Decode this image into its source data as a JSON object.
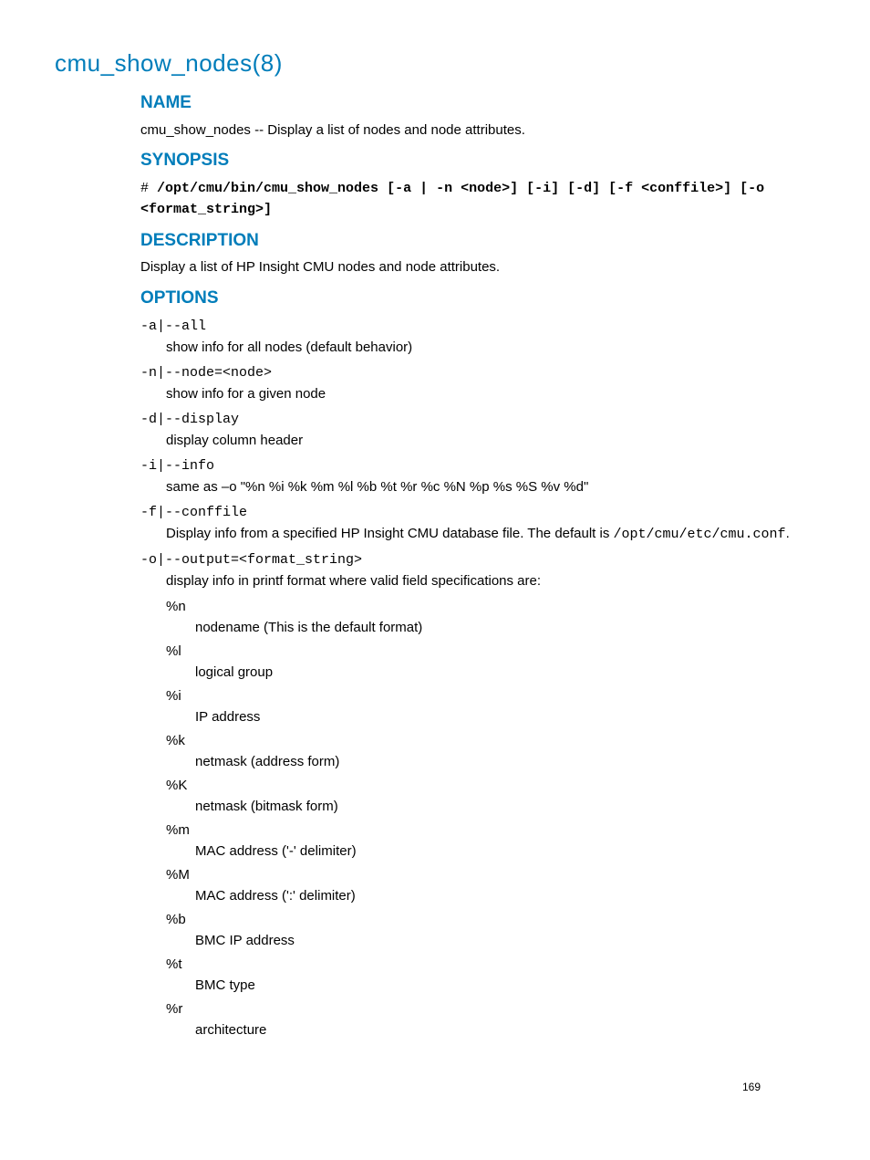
{
  "title": "cmu_show_nodes(8)",
  "sections": {
    "name": {
      "heading": "NAME",
      "text": "cmu_show_nodes -- Display a list of nodes and node attributes."
    },
    "synopsis": {
      "heading": "SYNOPSIS",
      "prefix": "# ",
      "cmd": "/opt/cmu/bin/cmu_show_nodes",
      "args": " [-a | -n <node>] [-i] [-d] [-f <conffile>] [-o <format_string>]"
    },
    "description": {
      "heading": "DESCRIPTION",
      "text": "Display a list of HP Insight CMU nodes and node attributes."
    },
    "options": {
      "heading": "OPTIONS",
      "items": [
        {
          "flag": "-a|--all",
          "desc": "show info for all nodes (default behavior)"
        },
        {
          "flag": "-n|--node=<node>",
          "desc": "show info for a given node"
        },
        {
          "flag": "-d|--display",
          "desc": "display column header"
        },
        {
          "flag": "-i|--info",
          "desc": "same as –o \"%n %i %k %m %l %b %t %r %c %N %p %s %S %v %d\""
        }
      ],
      "conffile": {
        "flag": "-f|--conffile",
        "desc_pre": "Display info from a specified HP Insight CMU database file. The default is ",
        "path": "/opt/cmu/etc/cmu.conf",
        "desc_post": "."
      },
      "output": {
        "flag": "-o|--output=<format_string>",
        "desc": "display info in printf format where valid field specifications are:",
        "specs": [
          {
            "code": "%n",
            "desc": "nodename (This is the default format)"
          },
          {
            "code": "%l",
            "desc": "logical group"
          },
          {
            "code": "%i",
            "desc": "IP address"
          },
          {
            "code": "%k",
            "desc": "netmask (address form)"
          },
          {
            "code": "%K",
            "desc": "netmask (bitmask form)"
          },
          {
            "code": "%m",
            "desc": "MAC address ('-' delimiter)"
          },
          {
            "code": "%M",
            "desc": "MAC address (':' delimiter)"
          },
          {
            "code": "%b",
            "desc": "BMC IP address"
          },
          {
            "code": "%t",
            "desc": "BMC type"
          },
          {
            "code": "%r",
            "desc": "architecture"
          }
        ]
      }
    }
  },
  "page_number": "169"
}
